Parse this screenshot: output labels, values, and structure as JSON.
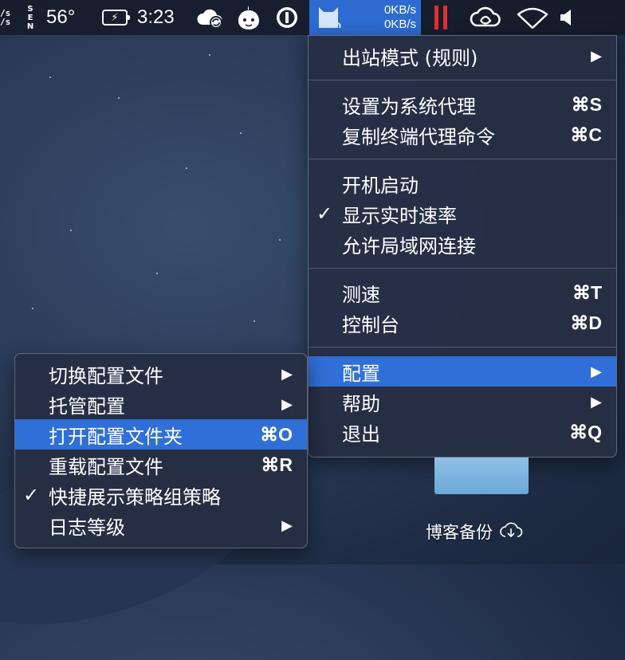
{
  "menubar": {
    "net_small": [
      "/s",
      "/s"
    ],
    "sensor_letters": [
      "S",
      "E",
      "N"
    ],
    "temperature": "56°",
    "battery_glyph": "⚡",
    "clock": "3:23",
    "speed_up": "0KB/s",
    "speed_down": "0KB/s",
    "icons": [
      "cloud-sync-icon",
      "ghost-app-icon",
      "onepassword-icon",
      "cat-proxy-icon",
      "pause-icon",
      "creative-cloud-icon",
      "wifi-icon",
      "volume-icon"
    ]
  },
  "main_menu": {
    "outbound_mode": {
      "label": "出站模式 (规则)",
      "arrow": "▶"
    },
    "set_system_proxy": {
      "label": "设置为系统代理",
      "shortcut": "⌘S"
    },
    "copy_terminal_cmd": {
      "label": "复制终端代理命令",
      "shortcut": "⌘C"
    },
    "launch_at_login": {
      "label": "开机启动"
    },
    "show_speed": {
      "label": "显示实时速率",
      "check": "✓"
    },
    "allow_lan": {
      "label": "允许局域网连接"
    },
    "speed_test": {
      "label": "测速",
      "shortcut": "⌘T"
    },
    "dashboard": {
      "label": "控制台",
      "shortcut": "⌘D"
    },
    "config": {
      "label": "配置",
      "arrow": "▶"
    },
    "help": {
      "label": "帮助",
      "arrow": "▶"
    },
    "quit": {
      "label": "退出",
      "shortcut": "⌘Q"
    }
  },
  "config_submenu": {
    "switch_profile": {
      "label": "切换配置文件",
      "arrow": "▶"
    },
    "managed_config": {
      "label": "托管配置",
      "arrow": "▶"
    },
    "open_config_folder": {
      "label": "打开配置文件夹",
      "shortcut": "⌘O"
    },
    "reload_config": {
      "label": "重载配置文件",
      "shortcut": "⌘R"
    },
    "quick_show_policy": {
      "label": "快捷展示策略组策略",
      "check": "✓"
    },
    "log_level": {
      "label": "日志等级",
      "arrow": "▶"
    }
  },
  "desktop": {
    "folder_label": "博客备份"
  },
  "colors": {
    "highlight": "#2f6fd7",
    "status_bg": "#2e6bd1",
    "pause": "#e5302b"
  }
}
